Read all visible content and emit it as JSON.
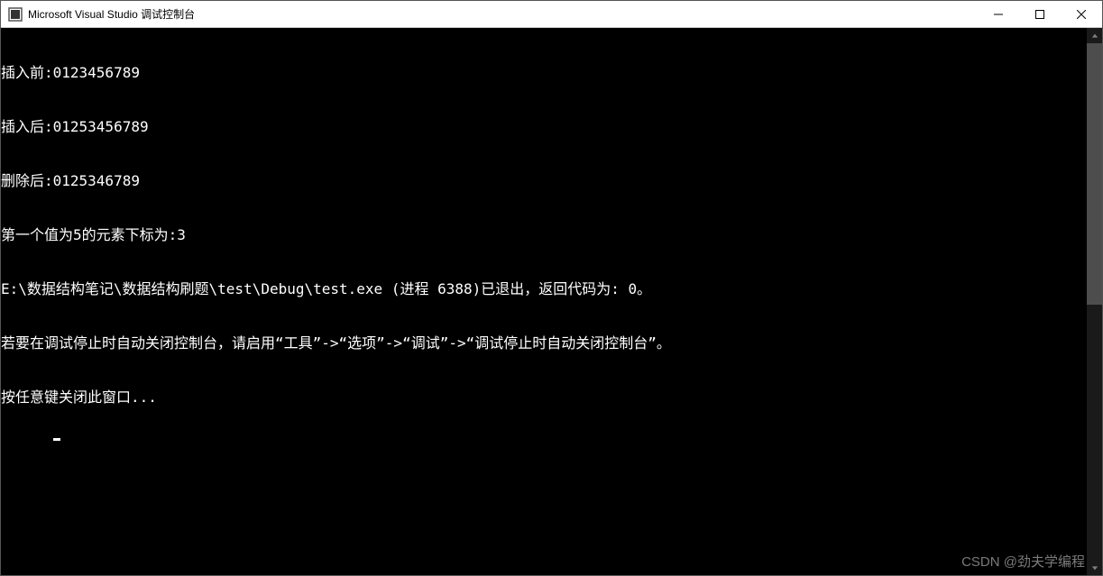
{
  "window": {
    "title": "Microsoft Visual Studio 调试控制台"
  },
  "console": {
    "lines": [
      "插入前:0123456789",
      "插入后:01253456789",
      "删除后:0125346789",
      "第一个值为5的元素下标为:3",
      "E:\\数据结构笔记\\数据结构刷题\\test\\Debug\\test.exe (进程 6388)已退出，返回代码为: 0。",
      "若要在调试停止时自动关闭控制台，请启用“工具”->“选项”->“调试”->“调试停止时自动关闭控制台”。",
      "按任意键关闭此窗口..."
    ]
  },
  "watermark": "CSDN @劲夫学编程"
}
